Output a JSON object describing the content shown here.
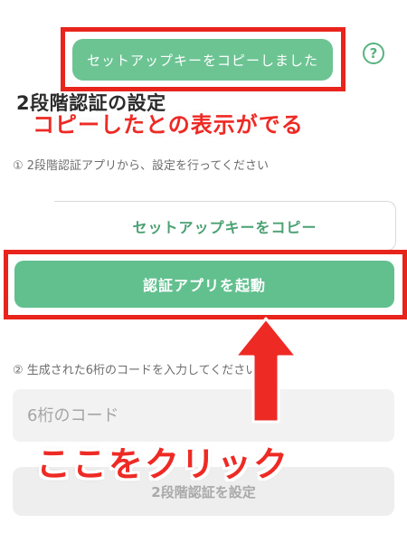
{
  "toast": {
    "text": "セットアップキーをコピーしました"
  },
  "help_icon": {
    "glyph": "?"
  },
  "page_title": "2段階認証の設定",
  "annotations": {
    "top": "コピーしたとの表示がでる",
    "bottom": "ここをクリック",
    "color": "#ee2a24"
  },
  "step1": {
    "label": "① 2段階認証アプリから、設定を行ってください"
  },
  "copy_button": {
    "label": "セットアップキーをコピー"
  },
  "launch_button": {
    "label": "認証アプリを起動"
  },
  "step2": {
    "label": "② 生成された6桁のコードを入力してください"
  },
  "code_input": {
    "placeholder": "6桁のコード"
  },
  "set_button": {
    "label": "2段階認証を設定"
  },
  "colors": {
    "accent": "#62c08f",
    "highlight": "#e8241c"
  }
}
